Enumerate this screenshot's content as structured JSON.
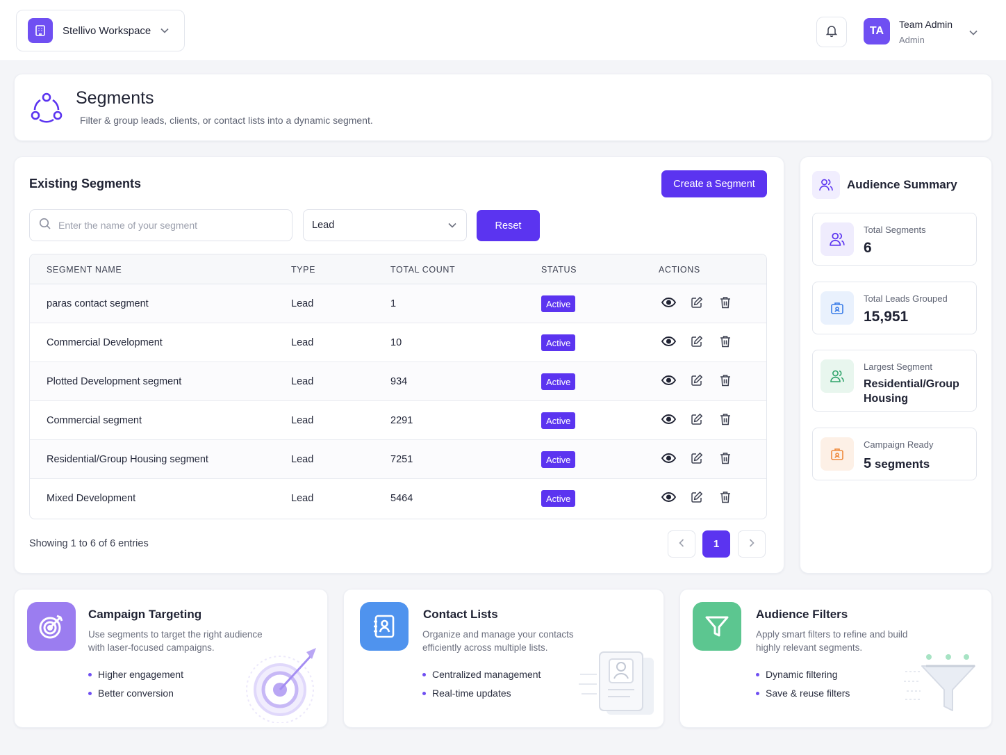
{
  "topbar": {
    "workspace_name": "Stellivo Workspace",
    "user_initials": "TA",
    "user_name": "Team Admin",
    "user_role": "Admin"
  },
  "header": {
    "title": "Segments",
    "subtitle": "Filter & group leads, clients, or contact lists into a dynamic segment."
  },
  "segments": {
    "title": "Existing Segments",
    "create_label": "Create a Segment",
    "search_placeholder": "Enter the name of your segment",
    "type_filter_value": "Lead",
    "reset_label": "Reset",
    "columns": [
      "SEGMENT NAME",
      "TYPE",
      "TOTAL COUNT",
      "STATUS",
      "ACTIONS"
    ],
    "rows": [
      {
        "name": "paras contact segment",
        "type": "Lead",
        "count": "1",
        "status": "Active"
      },
      {
        "name": "Commercial Development",
        "type": "Lead",
        "count": "10",
        "status": "Active"
      },
      {
        "name": "Plotted Development segment",
        "type": "Lead",
        "count": "934",
        "status": "Active"
      },
      {
        "name": "Commercial segment",
        "type": "Lead",
        "count": "2291",
        "status": "Active"
      },
      {
        "name": "Residential/Group Housing segment",
        "type": "Lead",
        "count": "7251",
        "status": "Active"
      },
      {
        "name": "Mixed Development",
        "type": "Lead",
        "count": "5464",
        "status": "Active"
      }
    ],
    "showing_text": "Showing 1 to 6 of 6 entries",
    "current_page": "1"
  },
  "audience": {
    "title": "Audience Summary",
    "stats": [
      {
        "label": "Total Segments",
        "value": "6"
      },
      {
        "label": "Total Leads Grouped",
        "value": "15,951"
      },
      {
        "label": "Largest Segment",
        "value": "Residential/Group Housing"
      },
      {
        "label": "Campaign Ready",
        "value_num": "5",
        "value_unit": "segments"
      }
    ]
  },
  "features": [
    {
      "title": "Campaign Targeting",
      "desc_line1": "Use segments to target the right audience",
      "desc_line2": "with laser-focused campaigns.",
      "bullets": [
        "Higher engagement",
        "Better conversion"
      ]
    },
    {
      "title": "Contact Lists",
      "desc_line1": "Organize and manage your contacts",
      "desc_line2": "efficiently across multiple lists.",
      "bullets": [
        "Centralized management",
        "Real-time updates"
      ]
    },
    {
      "title": "Audience Filters",
      "desc_line1": "Apply smart filters to refine and build",
      "desc_line2": "highly relevant segments.",
      "bullets": [
        "Dynamic filtering",
        "Save & reuse filters"
      ]
    }
  ],
  "colors": {
    "accent": "#5b34f0",
    "campaign_icon": "#9b7df0",
    "contact_icon": "#4f93ee",
    "filter_icon": "#5cc690"
  }
}
